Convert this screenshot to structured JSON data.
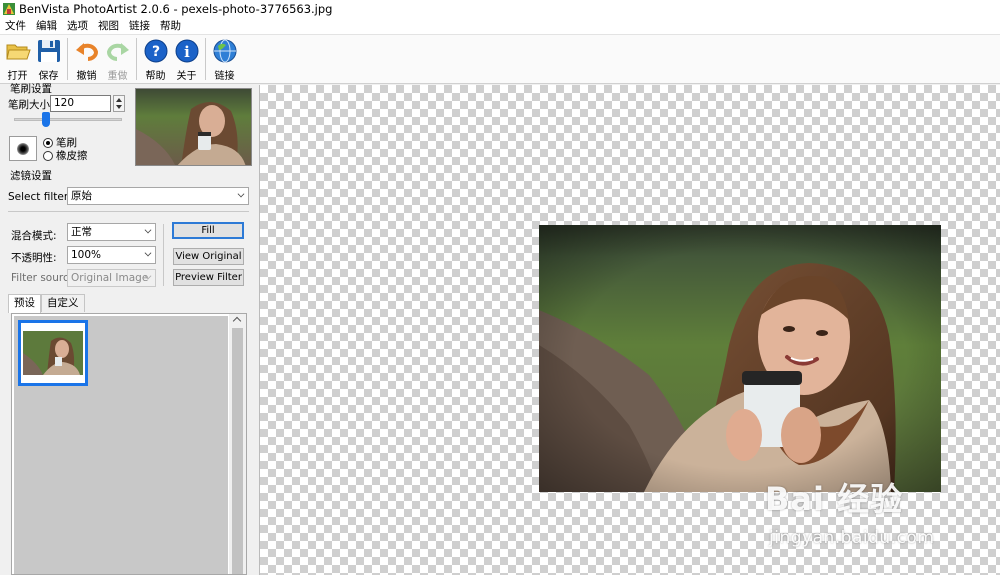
{
  "window": {
    "title": "BenVista PhotoArtist 2.0.6 - pexels-photo-3776563.jpg"
  },
  "menu": {
    "items": [
      "文件",
      "编辑",
      "选项",
      "视图",
      "链接",
      "帮助"
    ]
  },
  "toolbar": {
    "open": "打开",
    "save": "保存",
    "undo": "撤销",
    "redo": "重做",
    "help": "帮助",
    "about": "关于",
    "link": "链接"
  },
  "brush": {
    "group_title": "笔刷设置",
    "size_label": "笔刷大小:",
    "size_value": "120",
    "slider_fraction": 0.3,
    "mode_brush": "笔刷",
    "mode_eraser": "橡皮擦",
    "selected_mode": "笔刷"
  },
  "filter": {
    "group_title": "滤镜设置",
    "select_label": "Select filter:",
    "select_value": "原始",
    "blend_label": "混合模式:",
    "blend_value": "正常",
    "opacity_label": "不透明性:",
    "opacity_value": "100%",
    "source_label": "Filter source:",
    "source_value": "Original Image",
    "fill_button": "Fill",
    "view_original_button": "View Original",
    "preview_filter_button": "Preview Filter"
  },
  "tabs": [
    "预设",
    "自定义"
  ],
  "watermark": {
    "brand": "Bai 经验",
    "url": "jingyan.baidu.com"
  },
  "colors": {
    "accent": "#1a74e8",
    "checker": "#cfcfcf"
  }
}
